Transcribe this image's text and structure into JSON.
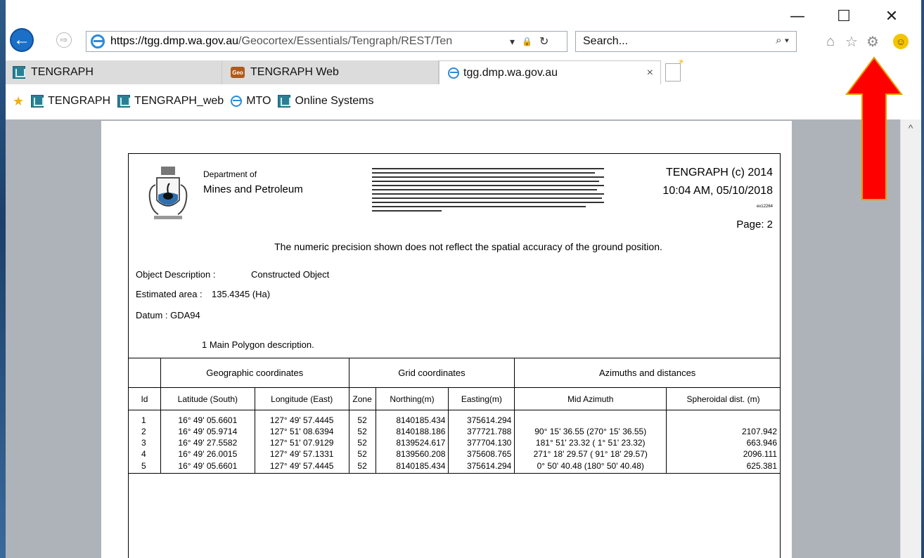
{
  "window": {
    "minimize": "—",
    "maximize": "☐",
    "close": "✕"
  },
  "navigation": {
    "back_icon": "←",
    "forward_icon": "⇨",
    "url_scheme": "https://tgg.",
    "url_domain": "dmp.wa.gov.au",
    "url_path": "/Geocortex/Essentials/Tengraph/REST/Ten",
    "dropdown_icon": "▾",
    "lock_icon": "🔒",
    "refresh_icon": "↻",
    "search_placeholder": "Search...",
    "search_icon": "⌕ ▾"
  },
  "toolbar": {
    "home_icon": "⌂",
    "favorites_icon": "☆",
    "settings_icon": "⚙",
    "smiley_icon": "☺"
  },
  "tabs": [
    {
      "label": "TENGRAPH"
    },
    {
      "label": "TENGRAPH Web",
      "badge": "Geo"
    },
    {
      "label": "tgg.dmp.wa.gov.au",
      "close": "×"
    }
  ],
  "favorites_bar": {
    "star_icon": "★",
    "items": [
      "TENGRAPH",
      "TENGRAPH_web",
      "MTO",
      "Online Systems"
    ]
  },
  "scroll_up_icon": "^",
  "document": {
    "dept_line1": "Department of",
    "dept_line2": "Mines and Petroleum",
    "tengraph_title": "TENGRAPH (c) 2014",
    "timestamp": "10:04 AM, 05/10/2018",
    "ref": "ex12264",
    "page": "Page: 2",
    "precision_note": "The numeric precision shown does not reflect the spatial accuracy of the ground position.",
    "object_description_label": "Object Description :",
    "object_description_value": "Constructed Object",
    "estimated_area_label": "Estimated area :",
    "estimated_area_value": "135.4345 (Ha)",
    "datum": "Datum : GDA94",
    "polygon_description": "1 Main Polygon description.",
    "table": {
      "group_headers": [
        "Geographic coordinates",
        "Grid coordinates",
        "Azimuths and distances"
      ],
      "columns": [
        "Id",
        "Latitude (South)",
        "Longitude (East)",
        "Zone",
        "Northing(m)",
        "Easting(m)",
        "Mid Azimuth",
        "Spheroidal dist. (m)"
      ],
      "rows": [
        [
          "1",
          "16° 49' 05.6601",
          "127° 49' 57.4445",
          "52",
          "8140185.434",
          "375614.294",
          "",
          ""
        ],
        [
          "2",
          "16° 49' 05.9714",
          "127° 51' 08.6394",
          "52",
          "8140188.186",
          "377721.788",
          "90° 15' 36.55 (270° 15' 36.55)",
          "2107.942"
        ],
        [
          "3",
          "16° 49' 27.5582",
          "127° 51' 07.9129",
          "52",
          "8139524.617",
          "377704.130",
          "181° 51' 23.32 ( 1° 51' 23.32)",
          "663.946"
        ],
        [
          "4",
          "16° 49' 26.0015",
          "127° 49' 57.1331",
          "52",
          "8139560.208",
          "375608.765",
          "271° 18' 29.57 ( 91° 18' 29.57)",
          "2096.111"
        ],
        [
          "5",
          "16° 49' 05.6601",
          "127° 49' 57.4445",
          "52",
          "8140185.434",
          "375614.294",
          "0° 50' 40.48 (180° 50' 40.48)",
          "625.381"
        ]
      ]
    }
  },
  "colors": {
    "annotation_arrow": "#ff0000",
    "ie_blue": "#1b6fc6"
  }
}
